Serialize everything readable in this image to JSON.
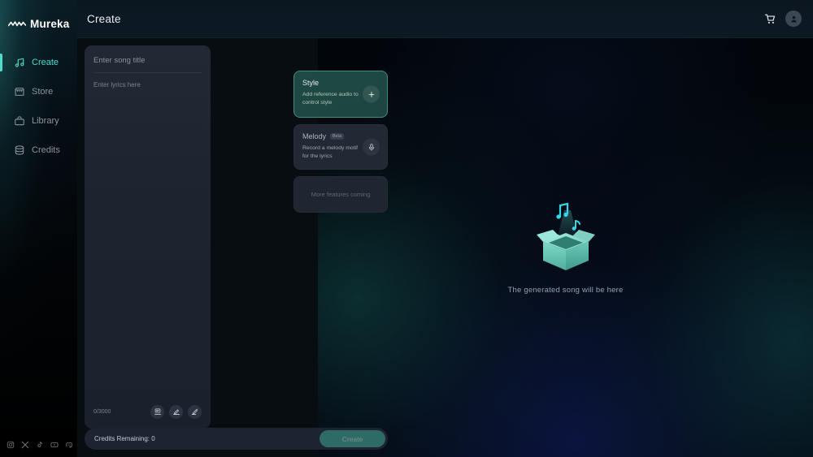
{
  "app": {
    "brand": "Mureka",
    "logo_icon": "waveform-logo-icon",
    "accent_color": "#4fdcc8",
    "panel_color": "#222935",
    "canvas_color": "#04070d"
  },
  "sidebar": {
    "items": [
      {
        "label": "Create",
        "icon": "music-note-icon",
        "active": true
      },
      {
        "label": "Store",
        "icon": "store-icon",
        "active": false
      },
      {
        "label": "Library",
        "icon": "library-bag-icon",
        "active": false
      },
      {
        "label": "Credits",
        "icon": "database-icon",
        "active": false
      }
    ],
    "socials": [
      {
        "name": "instagram-icon"
      },
      {
        "name": "x-twitter-icon"
      },
      {
        "name": "tiktok-icon"
      },
      {
        "name": "youtube-icon"
      },
      {
        "name": "discord-icon"
      }
    ]
  },
  "topbar": {
    "title": "Create",
    "cart_icon": "shopping-cart-icon",
    "avatar_icon": "user-avatar-icon"
  },
  "editor": {
    "title_placeholder": "Enter song title",
    "title_value": "",
    "lyrics_placeholder": "Enter lyrics here",
    "lyrics_value": "",
    "counter": "0/3000",
    "tools": [
      {
        "name": "lyrics-template-icon"
      },
      {
        "name": "write-lyrics-icon"
      },
      {
        "name": "ai-rewrite-icon"
      }
    ]
  },
  "cards": [
    {
      "id": "style",
      "title": "Style",
      "subtitle": "Add reference audio to control style",
      "action_icon": "plus-icon",
      "selected": true
    },
    {
      "id": "melody",
      "title": "Melody",
      "badge": "Beta",
      "subtitle": "Record a melody motif for the lyrics",
      "action_icon": "microphone-icon",
      "selected": false
    },
    {
      "id": "coming-soon",
      "title": "More features coming"
    }
  ],
  "footer": {
    "credits_label": "Credits Remaining: 0",
    "create_label": "Create"
  },
  "canvas": {
    "empty_text": "The generated song will be here",
    "empty_art_icon": "open-box-with-music-notes-icon"
  }
}
